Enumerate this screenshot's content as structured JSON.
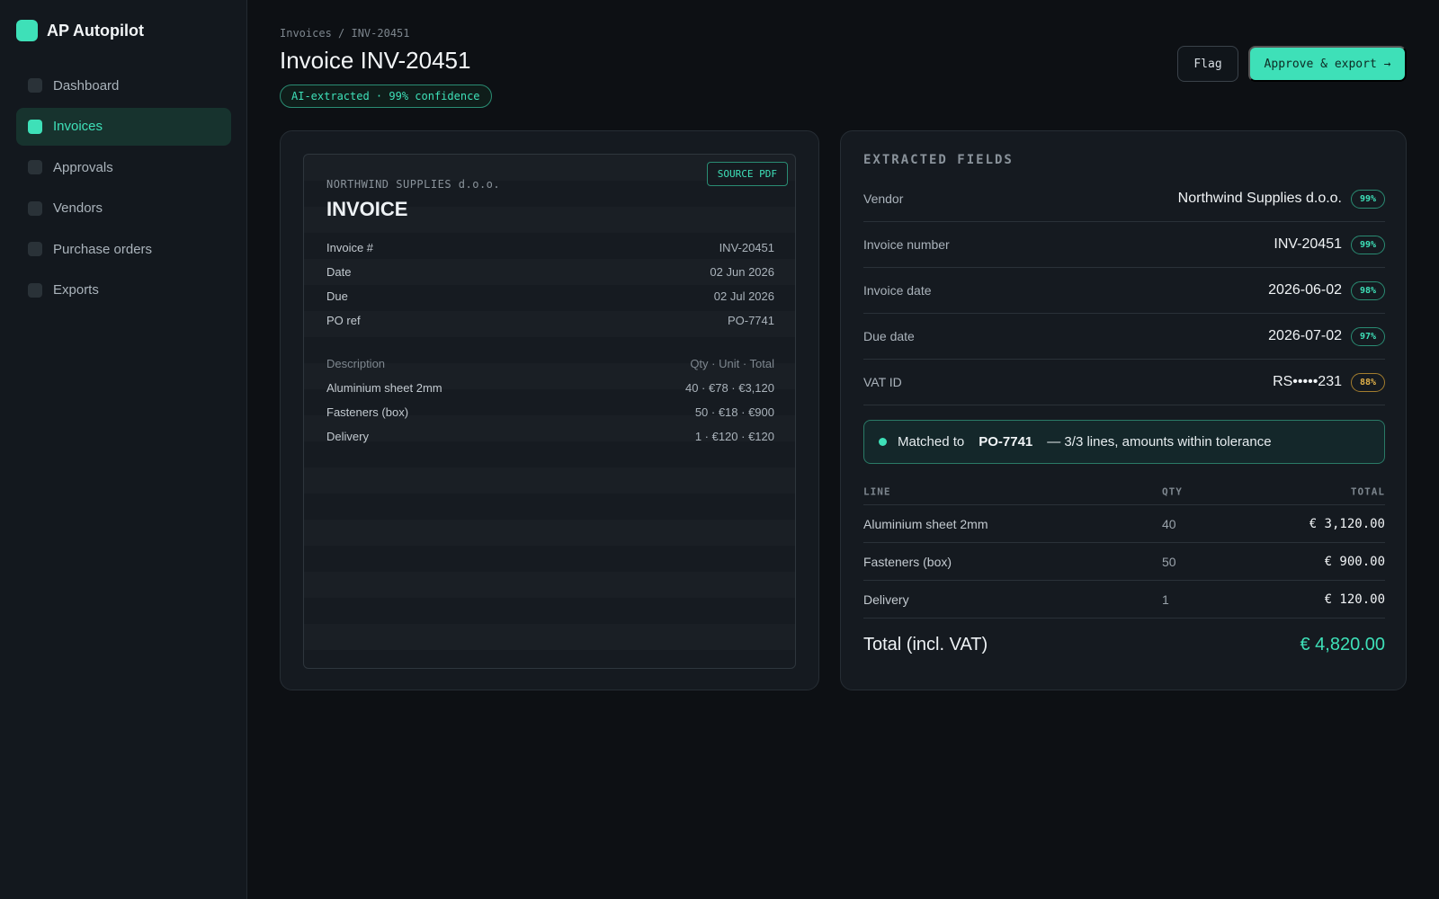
{
  "app": {
    "name": "AP Autopilot"
  },
  "sidebar": {
    "items": [
      {
        "label": "Dashboard",
        "active": false
      },
      {
        "label": "Invoices",
        "active": true
      },
      {
        "label": "Approvals",
        "active": false
      },
      {
        "label": "Vendors",
        "active": false
      },
      {
        "label": "Purchase orders",
        "active": false
      },
      {
        "label": "Exports",
        "active": false
      }
    ]
  },
  "header": {
    "breadcrumb": "Invoices / INV-20451",
    "title": "Invoice INV-20451",
    "ai_badge": "AI-extracted · 99% confidence",
    "flag_label": "Flag",
    "approve_label": "Approve & export →"
  },
  "document": {
    "source_label": "SOURCE PDF",
    "company": "NORTHWIND SUPPLIES d.o.o.",
    "heading": "INVOICE",
    "meta": [
      {
        "label": "Invoice #",
        "value": "INV-20451"
      },
      {
        "label": "Date",
        "value": "02 Jun 2026"
      },
      {
        "label": "Due",
        "value": "02 Jul 2026"
      },
      {
        "label": "PO ref",
        "value": "PO-7741"
      }
    ],
    "lines_header": {
      "label": "Description",
      "value": "Qty · Unit · Total"
    },
    "lines": [
      {
        "label": "Aluminium sheet 2mm",
        "value": "40 · €78 · €3,120"
      },
      {
        "label": "Fasteners (box)",
        "value": "50 · €18 · €900"
      },
      {
        "label": "Delivery",
        "value": "1 · €120 · €120"
      }
    ]
  },
  "extracted": {
    "title": "EXTRACTED FIELDS",
    "fields": [
      {
        "label": "Vendor",
        "value": "Northwind Supplies d.o.o.",
        "confidence": "99%"
      },
      {
        "label": "Invoice number",
        "value": "INV-20451",
        "confidence": "99%"
      },
      {
        "label": "Invoice date",
        "value": "2026-06-02",
        "confidence": "98%"
      },
      {
        "label": "Due date",
        "value": "2026-07-02",
        "confidence": "97%"
      },
      {
        "label": "VAT ID",
        "value": "RS•••••231",
        "confidence": "88%"
      }
    ],
    "match": {
      "prefix": "Matched to",
      "po": "PO-7741",
      "suffix": "— 3/3 lines, amounts within tolerance"
    },
    "lines_header": {
      "line": "LINE",
      "qty": "QTY",
      "total": "TOTAL"
    },
    "lines": [
      {
        "line": "Aluminium sheet 2mm",
        "qty": "40",
        "total": "€ 3,120.00"
      },
      {
        "line": "Fasteners (box)",
        "qty": "50",
        "total": "€ 900.00"
      },
      {
        "line": "Delivery",
        "qty": "1",
        "total": "€ 120.00"
      }
    ],
    "total_label": "Total (incl. VAT)",
    "total_value": "€ 4,820.00"
  },
  "colors": {
    "accent": "#3ee0b8",
    "warning": "#e0b04a",
    "background": "#0d1014"
  }
}
